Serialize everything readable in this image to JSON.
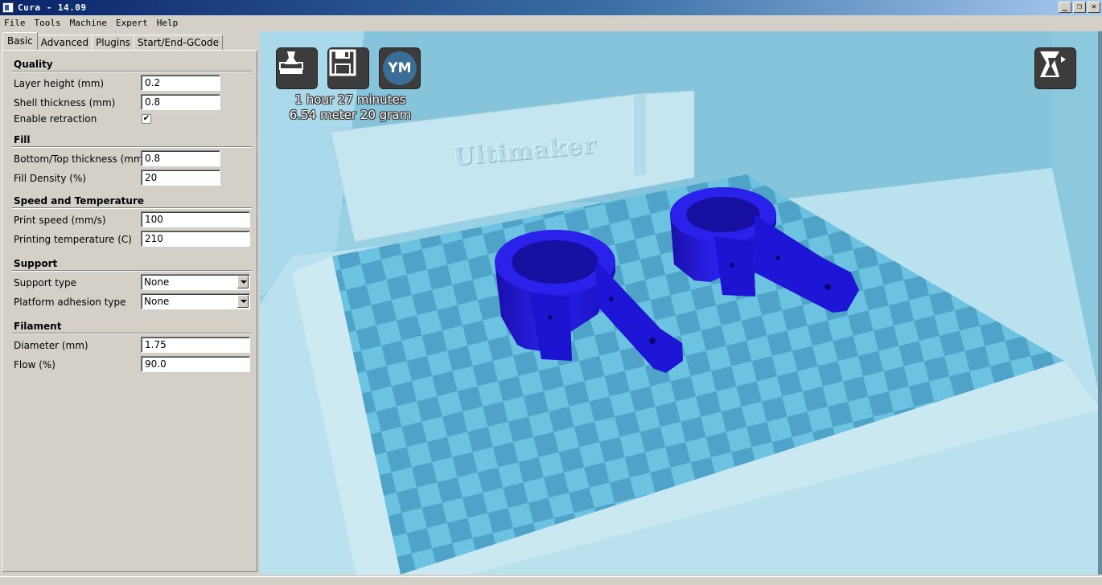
{
  "window": {
    "title": "Cura - 14.09"
  },
  "menu": [
    "File",
    "Tools",
    "Machine",
    "Expert",
    "Help"
  ],
  "tabs": [
    "Basic",
    "Advanced",
    "Plugins",
    "Start/End-GCode"
  ],
  "basic": {
    "quality": {
      "title": "Quality",
      "layer_height_label": "Layer height (mm)",
      "layer_height": "0.2",
      "shell_thickness_label": "Shell thickness (mm)",
      "shell_thickness": "0.8",
      "retraction_label": "Enable retraction",
      "retraction_checked": "✔"
    },
    "fill": {
      "title": "Fill",
      "bottom_top_label": "Bottom/Top thickness (mm)",
      "bottom_top": "0.8",
      "density_label": "Fill Density (%)",
      "density": "20"
    },
    "speed": {
      "title": "Speed and Temperature",
      "print_speed_label": "Print speed (mm/s)",
      "print_speed": "100",
      "temp_label": "Printing temperature (C)",
      "temp": "210"
    },
    "support": {
      "title": "Support",
      "support_type_label": "Support type",
      "support_type": "None",
      "adhesion_label": "Platform adhesion type",
      "adhesion": "None"
    },
    "filament": {
      "title": "Filament",
      "diameter_label": "Diameter (mm)",
      "diameter": "1.75",
      "flow_label": "Flow (%)",
      "flow": "90.0"
    }
  },
  "viewport": {
    "print_time": "1 hour 27 minutes",
    "print_material": "6.54 meter 20 gram",
    "ym_label": "YM",
    "watermark": "Ultimaker",
    "model_color": "#1f18d8",
    "bed_colors": [
      "#6cc2e1",
      "#4fa3c8"
    ]
  }
}
